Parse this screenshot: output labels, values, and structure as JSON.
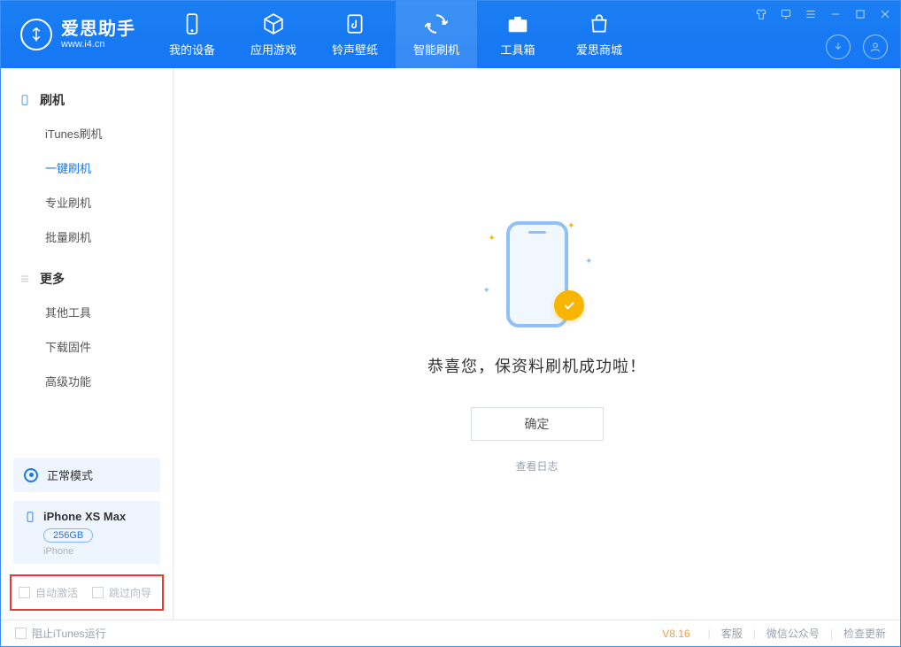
{
  "app": {
    "title": "爱思助手",
    "subtitle": "www.i4.cn"
  },
  "nav": {
    "items": [
      {
        "label": "我的设备"
      },
      {
        "label": "应用游戏"
      },
      {
        "label": "铃声壁纸"
      },
      {
        "label": "智能刷机"
      },
      {
        "label": "工具箱"
      },
      {
        "label": "爱思商城"
      }
    ]
  },
  "sidebar": {
    "group_flash": "刷机",
    "items_flash": [
      "iTunes刷机",
      "一键刷机",
      "专业刷机",
      "批量刷机"
    ],
    "group_more": "更多",
    "items_more": [
      "其他工具",
      "下载固件",
      "高级功能"
    ]
  },
  "device": {
    "mode": "正常模式",
    "name": "iPhone XS Max",
    "storage": "256GB",
    "type": "iPhone"
  },
  "checkboxes": {
    "auto_activate": "自动激活",
    "skip_guide": "跳过向导"
  },
  "main": {
    "success_msg": "恭喜您，保资料刷机成功啦！",
    "ok_button": "确定",
    "view_log": "查看日志"
  },
  "footer": {
    "block_itunes": "阻止iTunes运行",
    "version": "V8.16",
    "support": "客服",
    "wechat": "微信公众号",
    "check_update": "检查更新"
  }
}
